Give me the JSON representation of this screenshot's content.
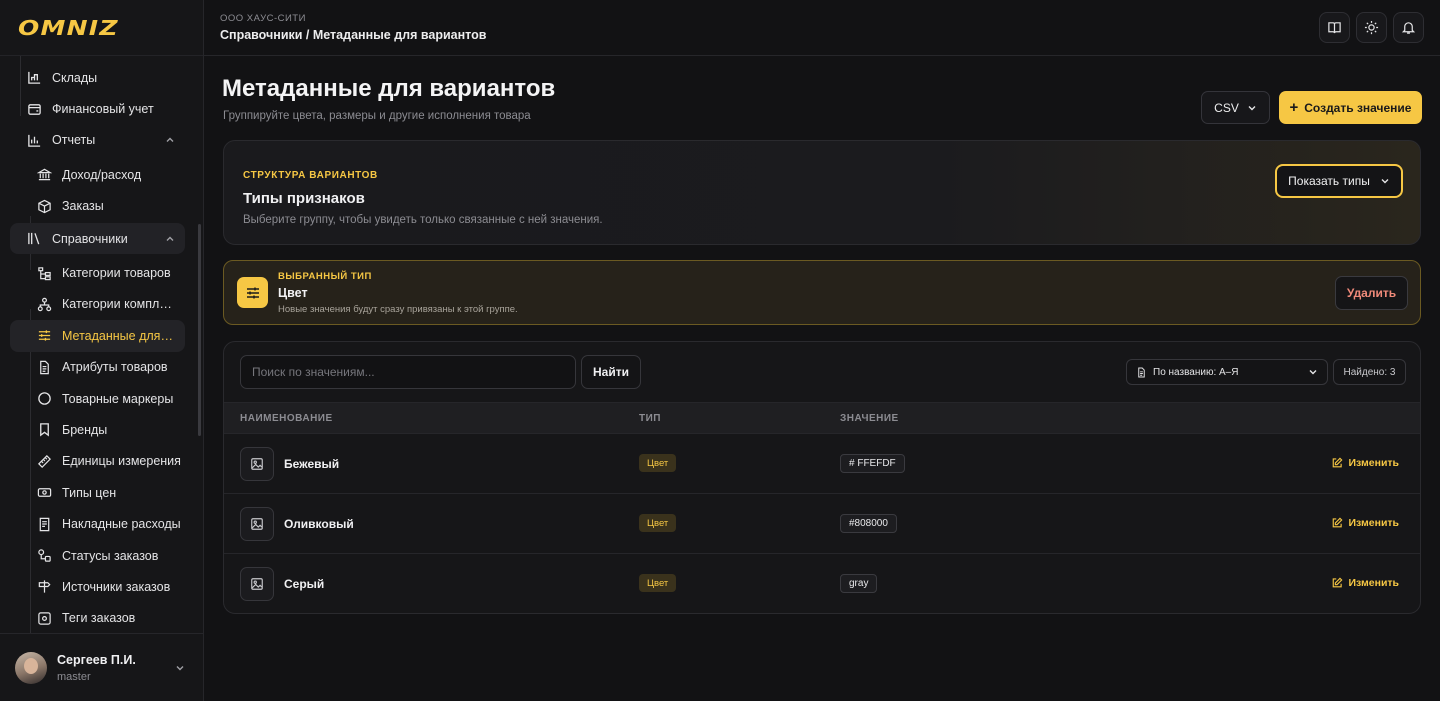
{
  "brand": {
    "logo": "OMNIZ",
    "accent": "#f6c744"
  },
  "sidebar": {
    "items": [
      {
        "label": "Склады",
        "icon": "warehouse-icon"
      },
      {
        "label": "Финансовый учет",
        "icon": "wallet-icon"
      },
      {
        "label": "Отчеты",
        "icon": "chart-icon"
      },
      {
        "label": "Доход/расход",
        "icon": "bank-icon"
      },
      {
        "label": "Заказы",
        "icon": "box-icon"
      },
      {
        "label": "Справочники",
        "icon": "library-icon"
      },
      {
        "label": "Категории товаров",
        "icon": "tree-icon"
      },
      {
        "label": "Категории комплектов",
        "icon": "hierarchy-icon"
      },
      {
        "label": "Метаданные для вариантов",
        "icon": "sliders-icon"
      },
      {
        "label": "Атрибуты товаров",
        "icon": "document-icon"
      },
      {
        "label": "Товарные маркеры",
        "icon": "circle-icon"
      },
      {
        "label": "Бренды",
        "icon": "bookmark-icon"
      },
      {
        "label": "Единицы измерения",
        "icon": "ruler-icon"
      },
      {
        "label": "Типы цен",
        "icon": "price-icon"
      },
      {
        "label": "Накладные расходы",
        "icon": "receipt-icon"
      },
      {
        "label": "Статусы заказов",
        "icon": "status-icon"
      },
      {
        "label": "Источники заказов",
        "icon": "signpost-icon"
      },
      {
        "label": "Теги заказов",
        "icon": "tag-icon"
      }
    ]
  },
  "user": {
    "name": "Сергеев П.И.",
    "role": "master"
  },
  "topbar": {
    "company": "ООО ХАУС-СИТИ",
    "breadcrumb": "Справочники / Метаданные для вариантов"
  },
  "page": {
    "title": "Метаданные для вариантов",
    "subtitle": "Группируйте цвета, размеры и другие исполнения товара",
    "csv_label": "CSV",
    "create_label": "Создать значение"
  },
  "structure": {
    "eyebrow": "СТРУКТУРА ВАРИАНТОВ",
    "title": "Типы признаков",
    "description": "Выберите группу, чтобы увидеть только связанные с ней значения.",
    "show_types_label": "Показать типы"
  },
  "selected": {
    "eyebrow": "ВЫБРАННЫЙ ТИП",
    "title": "Цвет",
    "description": "Новые значения будут сразу привязаны к этой группе.",
    "delete_label": "Удалить"
  },
  "table": {
    "search_placeholder": "Поиск по значениям...",
    "find_label": "Найти",
    "sort_label": "По названию: А–Я",
    "found_label": "Найдено: 3",
    "columns": [
      "НАИМЕНОВАНИЕ",
      "ТИП",
      "ЗНАЧЕНИЕ"
    ],
    "edit_label": "Изменить",
    "rows": [
      {
        "name": "Бежевый",
        "type": "Цвет",
        "value": "# FFEFDF"
      },
      {
        "name": "Оливковый",
        "type": "Цвет",
        "value": "#808000"
      },
      {
        "name": "Серый",
        "type": "Цвет",
        "value": "gray"
      }
    ]
  }
}
